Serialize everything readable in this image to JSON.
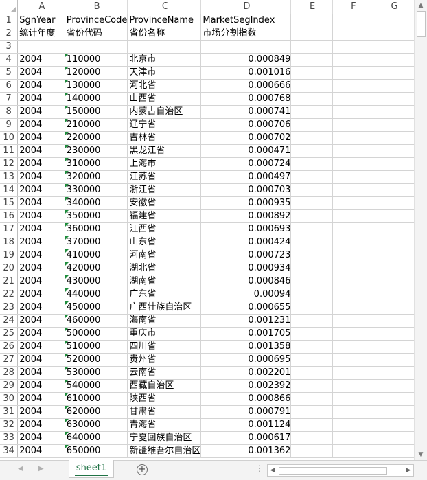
{
  "sheet": {
    "columns": [
      "A",
      "B",
      "C",
      "D",
      "E",
      "F",
      "G"
    ],
    "header_row": [
      "SgnYear",
      "ProvinceCode",
      "ProvinceName",
      "MarketSegIndex"
    ],
    "label_row": [
      "统计年度",
      "省份代码",
      "省份名称",
      "市场分割指数"
    ],
    "rows": [
      [
        "2004",
        "110000",
        "北京市",
        "0.000849"
      ],
      [
        "2004",
        "120000",
        "天津市",
        "0.001016"
      ],
      [
        "2004",
        "130000",
        "河北省",
        "0.000666"
      ],
      [
        "2004",
        "140000",
        "山西省",
        "0.000768"
      ],
      [
        "2004",
        "150000",
        "内蒙古自治区",
        "0.000741"
      ],
      [
        "2004",
        "210000",
        "辽宁省",
        "0.000706"
      ],
      [
        "2004",
        "220000",
        "吉林省",
        "0.000702"
      ],
      [
        "2004",
        "230000",
        "黑龙江省",
        "0.000471"
      ],
      [
        "2004",
        "310000",
        "上海市",
        "0.000724"
      ],
      [
        "2004",
        "320000",
        "江苏省",
        "0.000497"
      ],
      [
        "2004",
        "330000",
        "浙江省",
        "0.000703"
      ],
      [
        "2004",
        "340000",
        "安徽省",
        "0.000935"
      ],
      [
        "2004",
        "350000",
        "福建省",
        "0.000892"
      ],
      [
        "2004",
        "360000",
        "江西省",
        "0.000693"
      ],
      [
        "2004",
        "370000",
        "山东省",
        "0.000424"
      ],
      [
        "2004",
        "410000",
        "河南省",
        "0.000723"
      ],
      [
        "2004",
        "420000",
        "湖北省",
        "0.000934"
      ],
      [
        "2004",
        "430000",
        "湖南省",
        "0.000846"
      ],
      [
        "2004",
        "440000",
        "广东省",
        "0.00094"
      ],
      [
        "2004",
        "450000",
        "广西壮族自治区",
        "0.000655"
      ],
      [
        "2004",
        "460000",
        "海南省",
        "0.001231"
      ],
      [
        "2004",
        "500000",
        "重庆市",
        "0.001705"
      ],
      [
        "2004",
        "510000",
        "四川省",
        "0.001358"
      ],
      [
        "2004",
        "520000",
        "贵州省",
        "0.000695"
      ],
      [
        "2004",
        "530000",
        "云南省",
        "0.002201"
      ],
      [
        "2004",
        "540000",
        "西藏自治区",
        "0.002392"
      ],
      [
        "2004",
        "610000",
        "陕西省",
        "0.000866"
      ],
      [
        "2004",
        "620000",
        "甘肃省",
        "0.000791"
      ],
      [
        "2004",
        "630000",
        "青海省",
        "0.001124"
      ],
      [
        "2004",
        "640000",
        "宁夏回族自治区",
        "0.000617"
      ],
      [
        "2004",
        "650000",
        "新疆维吾尔自治区",
        "0.001362"
      ]
    ]
  },
  "tabs": {
    "sheet_name": "sheet1",
    "add_icon": "plus-circle-icon"
  },
  "colors": {
    "accent": "#217346",
    "marker": "#1e8c3c"
  }
}
